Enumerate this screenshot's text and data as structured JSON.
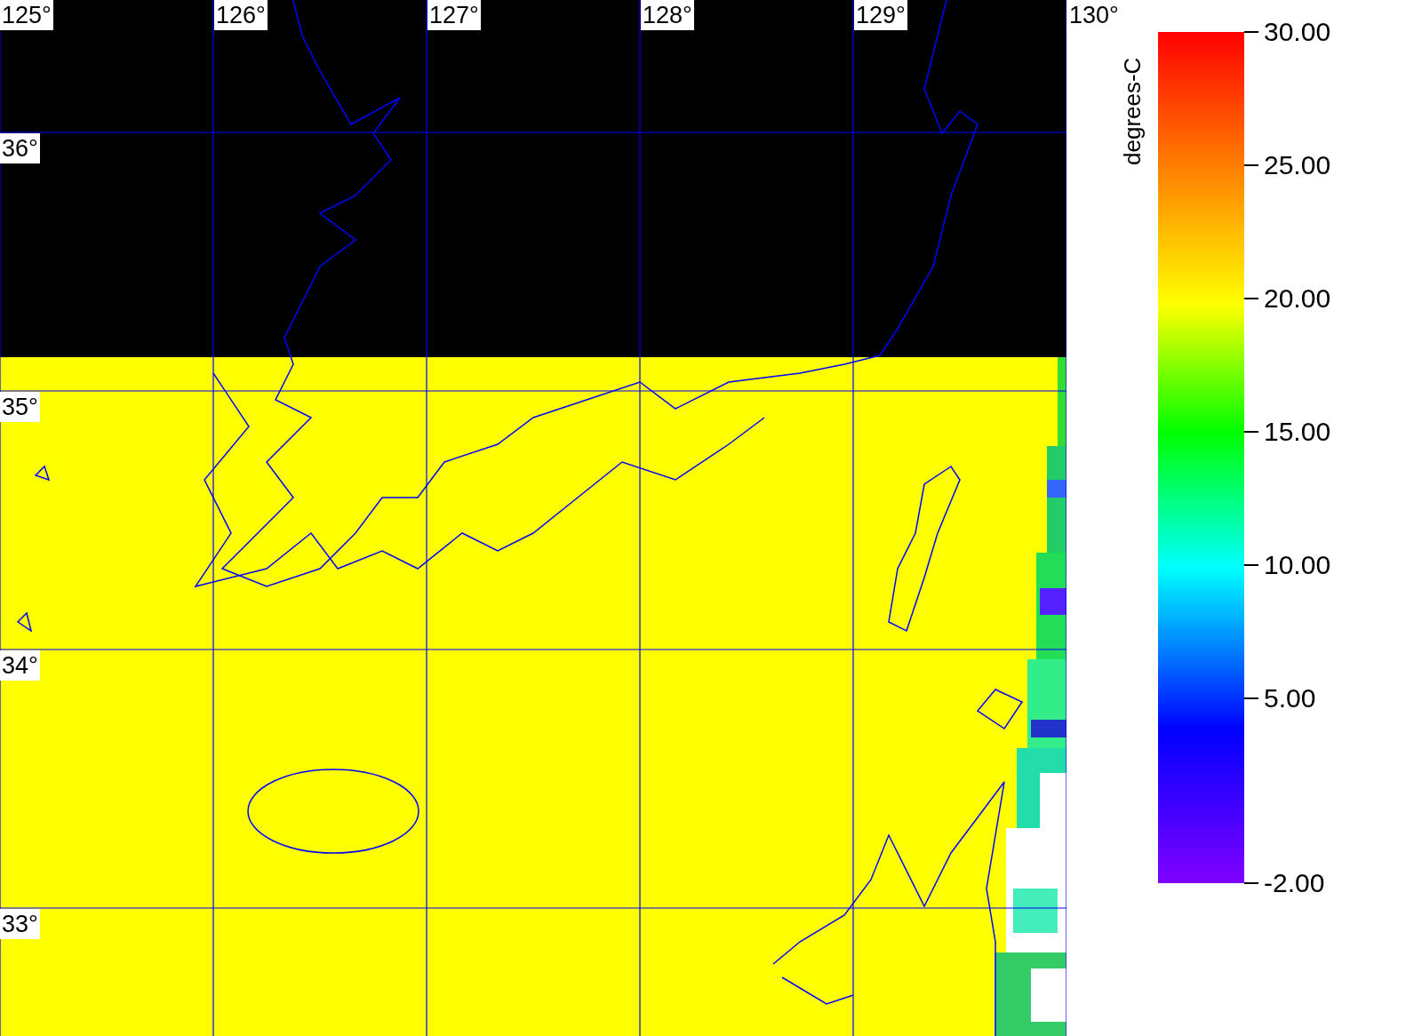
{
  "map": {
    "longitude_labels": [
      "125°",
      "126°",
      "127°",
      "128°",
      "129°",
      "130°"
    ],
    "latitude_labels": [
      "36°",
      "35°",
      "34°",
      "33°"
    ]
  },
  "colorbar": {
    "title": "degrees-C",
    "tick_labels": [
      "30.00",
      "25.00",
      "20.00",
      "15.00",
      "10.00",
      "5.00",
      "-2.00"
    ]
  }
}
